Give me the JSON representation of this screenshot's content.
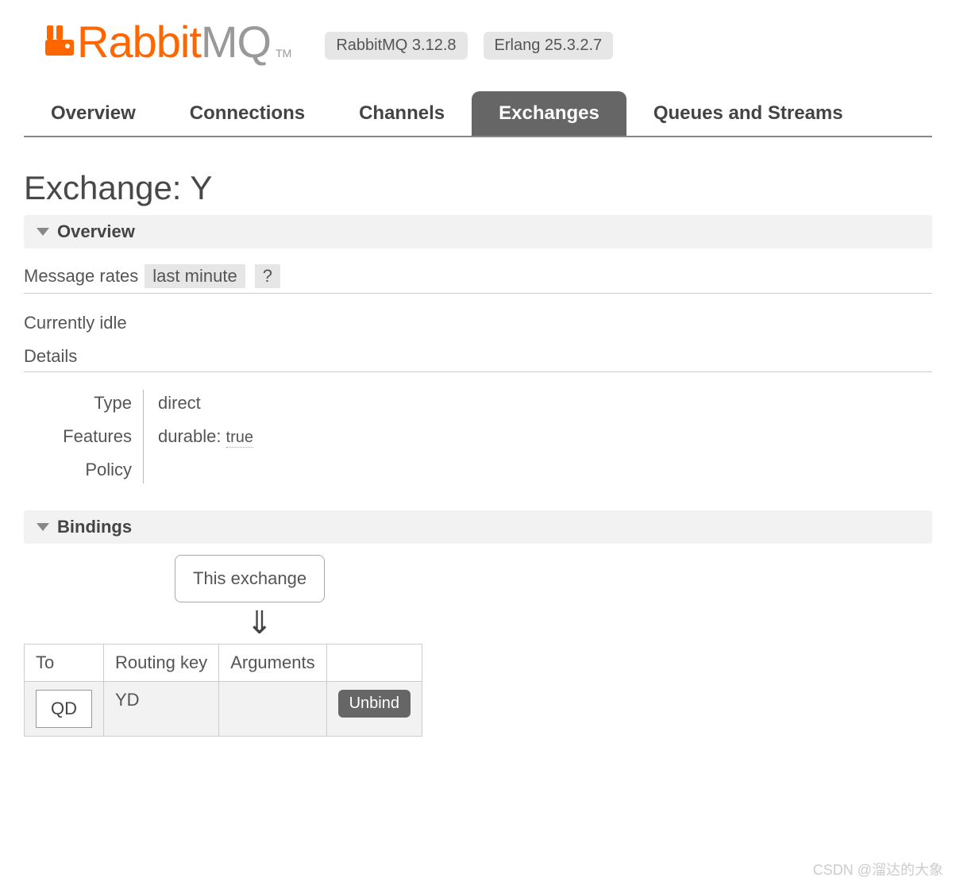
{
  "header": {
    "logo_rabbit": "Rabbit",
    "logo_mq": "MQ",
    "tm": "TM",
    "version_badge": "RabbitMQ 3.12.8",
    "erlang_badge": "Erlang 25.3.2.7"
  },
  "tabs": [
    {
      "label": "Overview",
      "active": false
    },
    {
      "label": "Connections",
      "active": false
    },
    {
      "label": "Channels",
      "active": false
    },
    {
      "label": "Exchanges",
      "active": true
    },
    {
      "label": "Queues and Streams",
      "active": false
    }
  ],
  "page_title": "Exchange: Y",
  "sections": {
    "overview": {
      "title": "Overview",
      "rates_label": "Message rates",
      "rates_range": "last minute",
      "help": "?",
      "idle_text": "Currently idle",
      "details_label": "Details",
      "details": {
        "type_label": "Type",
        "type_value": "direct",
        "features_label": "Features",
        "features_key": "durable:",
        "features_value": "true",
        "policy_label": "Policy",
        "policy_value": ""
      }
    },
    "bindings": {
      "title": "Bindings",
      "this_exchange_label": "This exchange",
      "arrow": "⇓",
      "columns": {
        "to": "To",
        "routing_key": "Routing key",
        "arguments": "Arguments",
        "action": ""
      },
      "rows": [
        {
          "to": "QD",
          "routing_key": "YD",
          "arguments": "",
          "action": "Unbind"
        }
      ]
    }
  },
  "watermark": "CSDN @溜达的大象"
}
